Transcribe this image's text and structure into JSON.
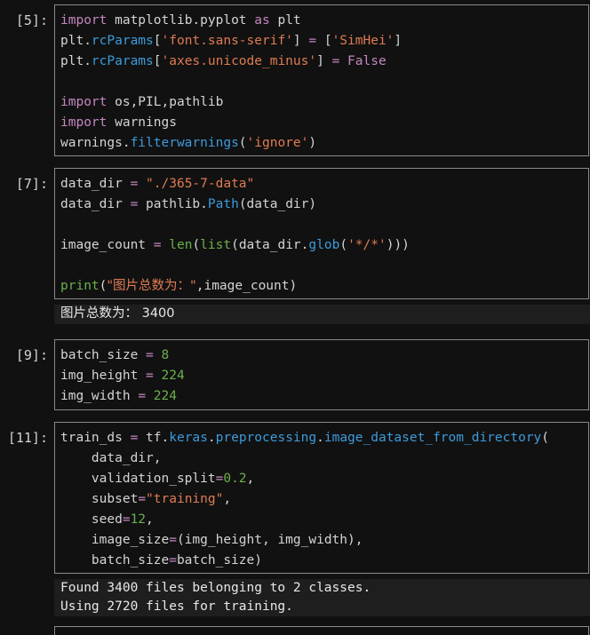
{
  "cells": [
    {
      "prompt": "[5]:",
      "lines": [
        [
          [
            "kw",
            "import"
          ],
          [
            "df",
            " matplotlib.pyplot "
          ],
          [
            "kw",
            "as"
          ],
          [
            "df",
            " plt"
          ]
        ],
        [
          [
            "df",
            "plt."
          ],
          [
            "at",
            "rcParams"
          ],
          [
            "df",
            "["
          ],
          [
            "st",
            "'font.sans-serif'"
          ],
          [
            "df",
            "] "
          ],
          [
            "op",
            "="
          ],
          [
            "df",
            " ["
          ],
          [
            "st",
            "'SimHei'"
          ],
          [
            "df",
            "]"
          ]
        ],
        [
          [
            "df",
            "plt."
          ],
          [
            "at",
            "rcParams"
          ],
          [
            "df",
            "["
          ],
          [
            "st",
            "'axes.unicode_minus'"
          ],
          [
            "df",
            "] "
          ],
          [
            "op",
            "="
          ],
          [
            "df",
            " "
          ],
          [
            "fb",
            "False"
          ]
        ],
        [],
        [
          [
            "kw",
            "import"
          ],
          [
            "df",
            " os,PIL,pathlib"
          ]
        ],
        [
          [
            "kw",
            "import"
          ],
          [
            "df",
            " warnings"
          ]
        ],
        [
          [
            "df",
            "warnings."
          ],
          [
            "at",
            "filterwarnings"
          ],
          [
            "df",
            "("
          ],
          [
            "st",
            "'ignore'"
          ],
          [
            "df",
            ")"
          ]
        ]
      ]
    },
    {
      "prompt": "[7]:",
      "lines": [
        [
          [
            "df",
            "data_dir "
          ],
          [
            "op",
            "="
          ],
          [
            "df",
            " "
          ],
          [
            "st",
            "\"./365-7-data\""
          ]
        ],
        [
          [
            "df",
            "data_dir "
          ],
          [
            "op",
            "="
          ],
          [
            "df",
            " pathlib."
          ],
          [
            "at",
            "Path"
          ],
          [
            "df",
            "(data_dir)"
          ]
        ],
        [],
        [
          [
            "df",
            "image_count "
          ],
          [
            "op",
            "="
          ],
          [
            "df",
            " "
          ],
          [
            "bi",
            "len"
          ],
          [
            "df",
            "("
          ],
          [
            "bi",
            "list"
          ],
          [
            "df",
            "(data_dir."
          ],
          [
            "at",
            "glob"
          ],
          [
            "df",
            "("
          ],
          [
            "st",
            "'*/*'"
          ],
          [
            "df",
            ")))"
          ]
        ],
        [],
        [
          [
            "bi",
            "print"
          ],
          [
            "df",
            "("
          ],
          [
            "st",
            "\"图片总数为：\""
          ],
          [
            "df",
            ",image_count)"
          ]
        ]
      ],
      "output": [
        "图片总数为： 3400"
      ]
    },
    {
      "prompt": "[9]:",
      "lines": [
        [
          [
            "df",
            "batch_size "
          ],
          [
            "op",
            "="
          ],
          [
            "df",
            " "
          ],
          [
            "nm",
            "8"
          ]
        ],
        [
          [
            "df",
            "img_height "
          ],
          [
            "op",
            "="
          ],
          [
            "df",
            " "
          ],
          [
            "nm",
            "224"
          ]
        ],
        [
          [
            "df",
            "img_width "
          ],
          [
            "op",
            "="
          ],
          [
            "df",
            " "
          ],
          [
            "nm",
            "224"
          ]
        ]
      ]
    },
    {
      "prompt": "[11]:",
      "lines": [
        [
          [
            "df",
            "train_ds "
          ],
          [
            "op",
            "="
          ],
          [
            "df",
            " tf."
          ],
          [
            "at",
            "keras"
          ],
          [
            "df",
            "."
          ],
          [
            "at",
            "preprocessing"
          ],
          [
            "df",
            "."
          ],
          [
            "at",
            "image_dataset_from_directory"
          ],
          [
            "df",
            "("
          ]
        ],
        [
          [
            "df",
            "    data_dir,"
          ]
        ],
        [
          [
            "df",
            "    validation_split"
          ],
          [
            "op",
            "="
          ],
          [
            "nm",
            "0.2"
          ],
          [
            "df",
            ","
          ]
        ],
        [
          [
            "df",
            "    subset"
          ],
          [
            "op",
            "="
          ],
          [
            "st",
            "\"training\""
          ],
          [
            "df",
            ","
          ]
        ],
        [
          [
            "df",
            "    seed"
          ],
          [
            "op",
            "="
          ],
          [
            "nm",
            "12"
          ],
          [
            "df",
            ","
          ]
        ],
        [
          [
            "df",
            "    image_size"
          ],
          [
            "op",
            "="
          ],
          [
            "df",
            "(img_height, img_width),"
          ]
        ],
        [
          [
            "df",
            "    batch_size"
          ],
          [
            "op",
            "="
          ],
          [
            "df",
            "batch_size)"
          ]
        ]
      ],
      "output": [
        "Found 3400 files belonging to 2 classes.",
        "Using 2720 files for training."
      ]
    }
  ]
}
